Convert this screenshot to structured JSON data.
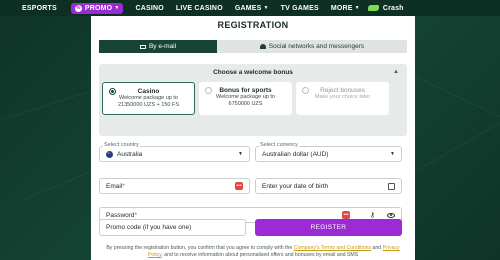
{
  "nav": {
    "items": [
      {
        "label": "ESPORTS"
      },
      {
        "label": "PROMO"
      },
      {
        "label": "CASINO"
      },
      {
        "label": "LIVE CASINO"
      },
      {
        "label": "GAMES"
      },
      {
        "label": "TV GAMES"
      },
      {
        "label": "MORE"
      },
      {
        "label": "Crash"
      }
    ],
    "promo_color": "#9b2bd4"
  },
  "modal": {
    "title": "REGISTRATION",
    "tabs": [
      {
        "label": "By e-mail",
        "active": true
      },
      {
        "label": "Social networks and messengers",
        "active": false
      }
    ],
    "bonus": {
      "heading": "Choose a welcome bonus",
      "options": [
        {
          "title": "Casino",
          "line1": "Welcome package up to",
          "line2": "21350000 UZS + 150 FS",
          "selected": true
        },
        {
          "title": "Bonus for sports",
          "line1": "Welcome package up to",
          "line2": "6750000 UZS",
          "selected": false
        },
        {
          "title": "Reject bonuses",
          "line1": "Make your choice later",
          "line2": "",
          "selected": false
        }
      ]
    },
    "country": {
      "label": "Select country",
      "value": "Australia"
    },
    "currency": {
      "label": "Select currency",
      "value": "Australian dollar (AUD)"
    },
    "email": {
      "placeholder": "Email",
      "required_mark": "*"
    },
    "birth": {
      "placeholder": "Enter your date of birth"
    },
    "password": {
      "placeholder": "Password",
      "required_mark": "*"
    },
    "promo": {
      "placeholder": "Promo code (if you have one)"
    },
    "register_label": "REGISTER",
    "register_color": "#9b2bd4",
    "terms": {
      "prefix": "By pressing the registration button, you confirm that you agree to comply with the",
      "link1": "Company's Terms and Conditions",
      "and": "and",
      "link2": "Privacy",
      "line2_link": "Policy",
      "suffix": ", and to receive information about personalised offers and bonuses by email and SMS"
    }
  }
}
